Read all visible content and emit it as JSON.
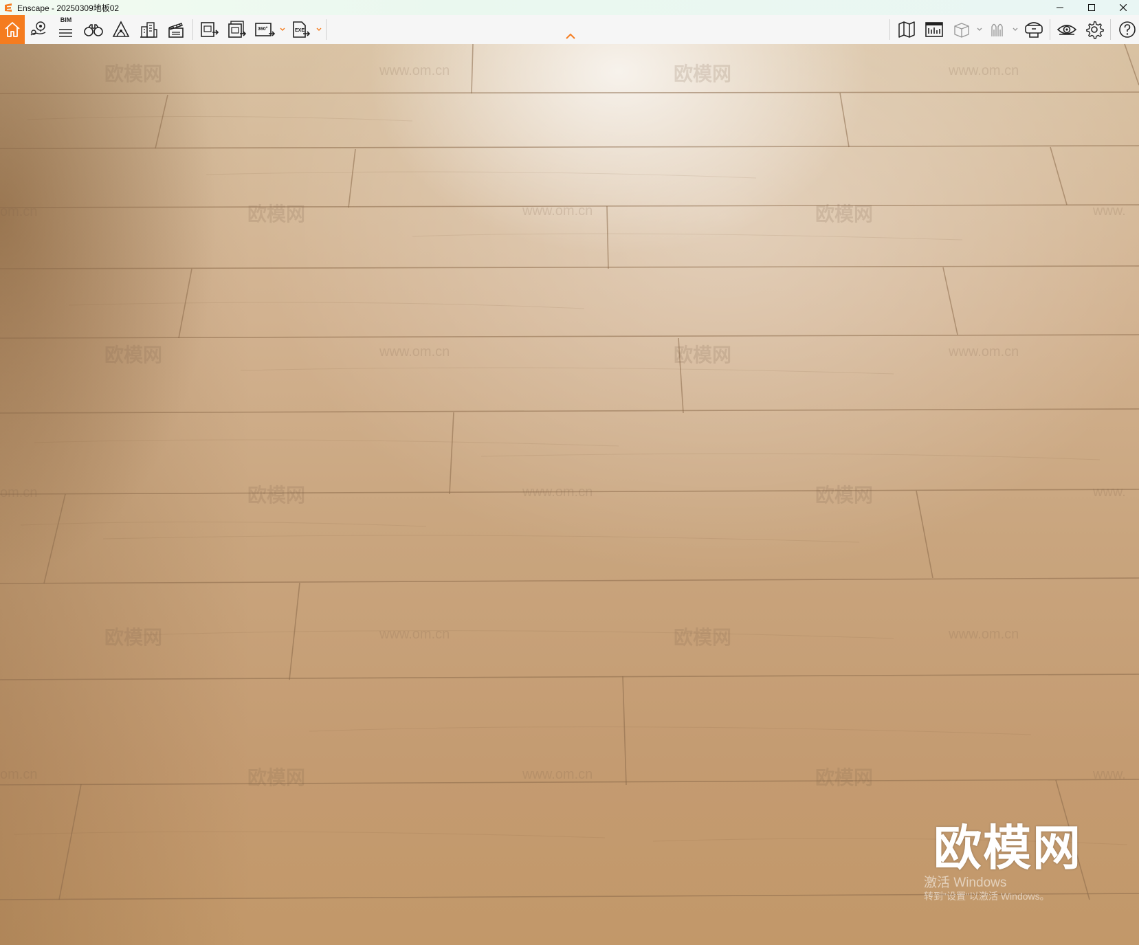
{
  "window": {
    "app_icon": "enscape-logo-icon",
    "title": "Enscape - 20250309地板02",
    "controls": [
      "minimize-icon",
      "maximize-icon",
      "close-icon"
    ]
  },
  "toolbar": {
    "accent_color": "#f57c1f",
    "bim_label": "BIM",
    "left_tools": [
      {
        "name": "home",
        "icon": "home-icon",
        "active": true
      },
      {
        "name": "views",
        "icon": "location-pin-icon"
      },
      {
        "name": "bim",
        "icon": "bim-list-icon"
      },
      {
        "name": "asset-library",
        "icon": "binoculars-icon"
      },
      {
        "name": "atmosphere",
        "icon": "atmosphere-icon"
      },
      {
        "name": "site-context",
        "icon": "buildings-icon"
      },
      {
        "name": "video-editor",
        "icon": "clapper-icon"
      },
      {
        "name": "screenshot",
        "icon": "render-export-icon"
      },
      {
        "name": "batch-render",
        "icon": "batch-render-icon"
      },
      {
        "name": "panorama",
        "icon": "panorama-360-icon",
        "label": "360°",
        "has_dropdown": true
      },
      {
        "name": "standalone-export",
        "icon": "exe-export-icon",
        "label": "EXE",
        "has_dropdown": true
      }
    ],
    "right_tools": [
      {
        "name": "map",
        "icon": "map-icon"
      },
      {
        "name": "info",
        "icon": "info-panel-icon"
      },
      {
        "name": "cube-view",
        "icon": "cube-icon",
        "has_dropdown": true
      },
      {
        "name": "vr",
        "icon": "vr-icon",
        "has_dropdown": true
      },
      {
        "name": "headset",
        "icon": "vr-headset-icon"
      },
      {
        "name": "visibility",
        "icon": "eye-icon"
      },
      {
        "name": "settings",
        "icon": "gear-icon"
      },
      {
        "name": "help",
        "icon": "help-icon"
      }
    ],
    "collapse_icon": "chevron-up-icon"
  },
  "viewport": {
    "watermark_brand": "欧模网",
    "watermark_url": "www.om.cn",
    "watermark_url_fragment": "om.cn",
    "watermark_url_partial": "www.",
    "big_logo": "欧模网",
    "activation_title": "激活 Windows",
    "activation_subtitle": "转到\"设置\"以激活 Windows。"
  }
}
